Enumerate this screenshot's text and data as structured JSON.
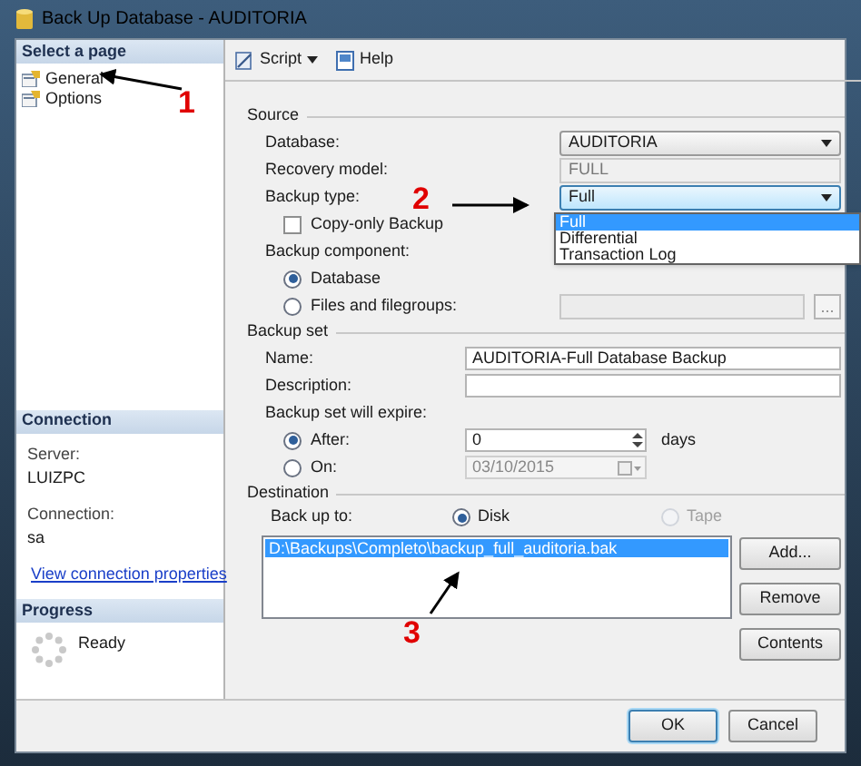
{
  "window": {
    "title": "Back Up Database - AUDITORIA"
  },
  "sidebar": {
    "header": "Select a page",
    "pages": [
      {
        "label": "General"
      },
      {
        "label": "Options"
      }
    ]
  },
  "connection": {
    "header": "Connection",
    "server_label": "Server:",
    "server": "LUIZPC",
    "connection_label": "Connection:",
    "connection": "sa",
    "link": "View connection properties"
  },
  "progress": {
    "header": "Progress",
    "status": "Ready"
  },
  "toolbar": [
    {
      "label": "Script",
      "kind": "script"
    },
    {
      "label": "Help",
      "kind": "help"
    }
  ],
  "source": {
    "title": "Source",
    "database_label": "Database:",
    "database": "AUDITORIA",
    "recovery_label": "Recovery model:",
    "recovery": "FULL",
    "backup_type_label": "Backup type:",
    "backup_type": "Full",
    "backup_type_options": [
      {
        "label": "Full",
        "selected": true
      },
      {
        "label": "Differential",
        "selected": false
      },
      {
        "label": "Transaction Log",
        "selected": false
      }
    ],
    "copy_only": {
      "label": "Copy-only Backup",
      "checked": false
    },
    "component_label": "Backup component:",
    "components": [
      {
        "label": "Database",
        "selected": true
      },
      {
        "label": "Files and filegroups:",
        "selected": false
      }
    ],
    "browse": "..."
  },
  "backup_set": {
    "title": "Backup set",
    "name_label": "Name:",
    "name": "AUDITORIA-Full Database Backup",
    "description_label": "Description:",
    "expire_label": "Backup set will expire:",
    "after": {
      "label": "After:",
      "selected": true,
      "value": "0",
      "unit": "days"
    },
    "on": {
      "label": "On:",
      "selected": false,
      "value": "03/10/2015",
      "disabled": true
    }
  },
  "destination": {
    "title": "Destination",
    "back_up_to_label": "Back up to:",
    "media": [
      {
        "label": "Disk",
        "selected": true,
        "disabled": false
      },
      {
        "label": "Tape",
        "selected": false,
        "disabled": true
      }
    ],
    "files": [
      {
        "path": "D:\\Backups\\Completo\\backup_full_auditoria.bak",
        "selected": true
      }
    ],
    "buttons": [
      "Add...",
      "Remove",
      "Contents"
    ]
  },
  "footer_buttons": [
    {
      "label": "OK",
      "default": true
    },
    {
      "label": "Cancel",
      "default": false
    }
  ],
  "annotations": [
    "1",
    "2",
    "3"
  ]
}
